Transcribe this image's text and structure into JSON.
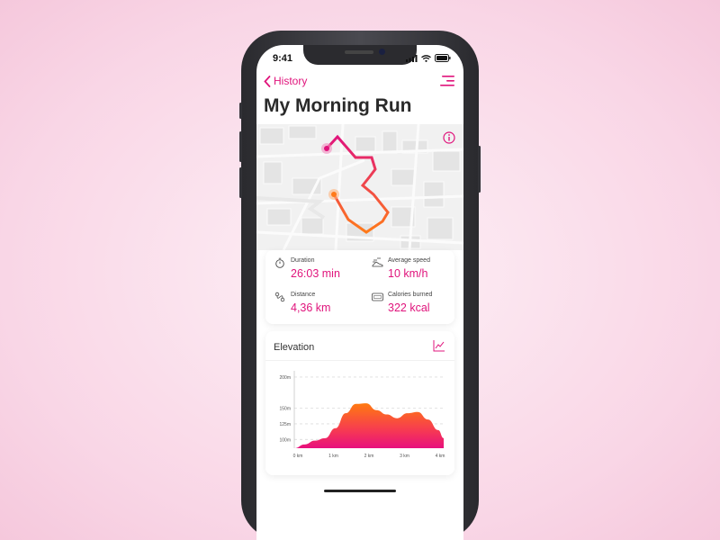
{
  "status": {
    "time": "9:41"
  },
  "nav": {
    "back_label": "History"
  },
  "page": {
    "title": "My Morning Run"
  },
  "stats": {
    "duration": {
      "label": "Duration",
      "value": "26:03 min"
    },
    "avg_speed": {
      "label": "Average speed",
      "value": "10 km/h"
    },
    "distance": {
      "label": "Distance",
      "value": "4,36 km"
    },
    "calories": {
      "label": "Calories burned",
      "value": "322 kcal"
    }
  },
  "elevation": {
    "title": "Elevation"
  },
  "colors": {
    "accent": "#e0147c",
    "route_start": "#e0147c",
    "route_end": "#ff7a1a"
  },
  "chart_data": {
    "type": "area",
    "ylabel": "",
    "xlabel": "",
    "x_tick_labels": [
      "0 km",
      "1 km",
      "2 km",
      "3 km",
      "4 km"
    ],
    "y_tick_labels": [
      "100m",
      "125m",
      "150m",
      "200m"
    ],
    "y_tick_values": [
      100,
      125,
      150,
      200
    ],
    "x": [
      0,
      0.3,
      0.6,
      0.9,
      1.2,
      1.5,
      1.8,
      2.1,
      2.4,
      2.7,
      3.0,
      3.3,
      3.6,
      3.9,
      4.2,
      4.36
    ],
    "series": [
      {
        "values": [
          86,
          92,
          98,
          102,
          118,
          142,
          157,
          158,
          147,
          140,
          134,
          142,
          144,
          132,
          115,
          102
        ]
      }
    ],
    "xlim": [
      0,
      4.36
    ],
    "ylim": [
      86,
      210
    ]
  }
}
